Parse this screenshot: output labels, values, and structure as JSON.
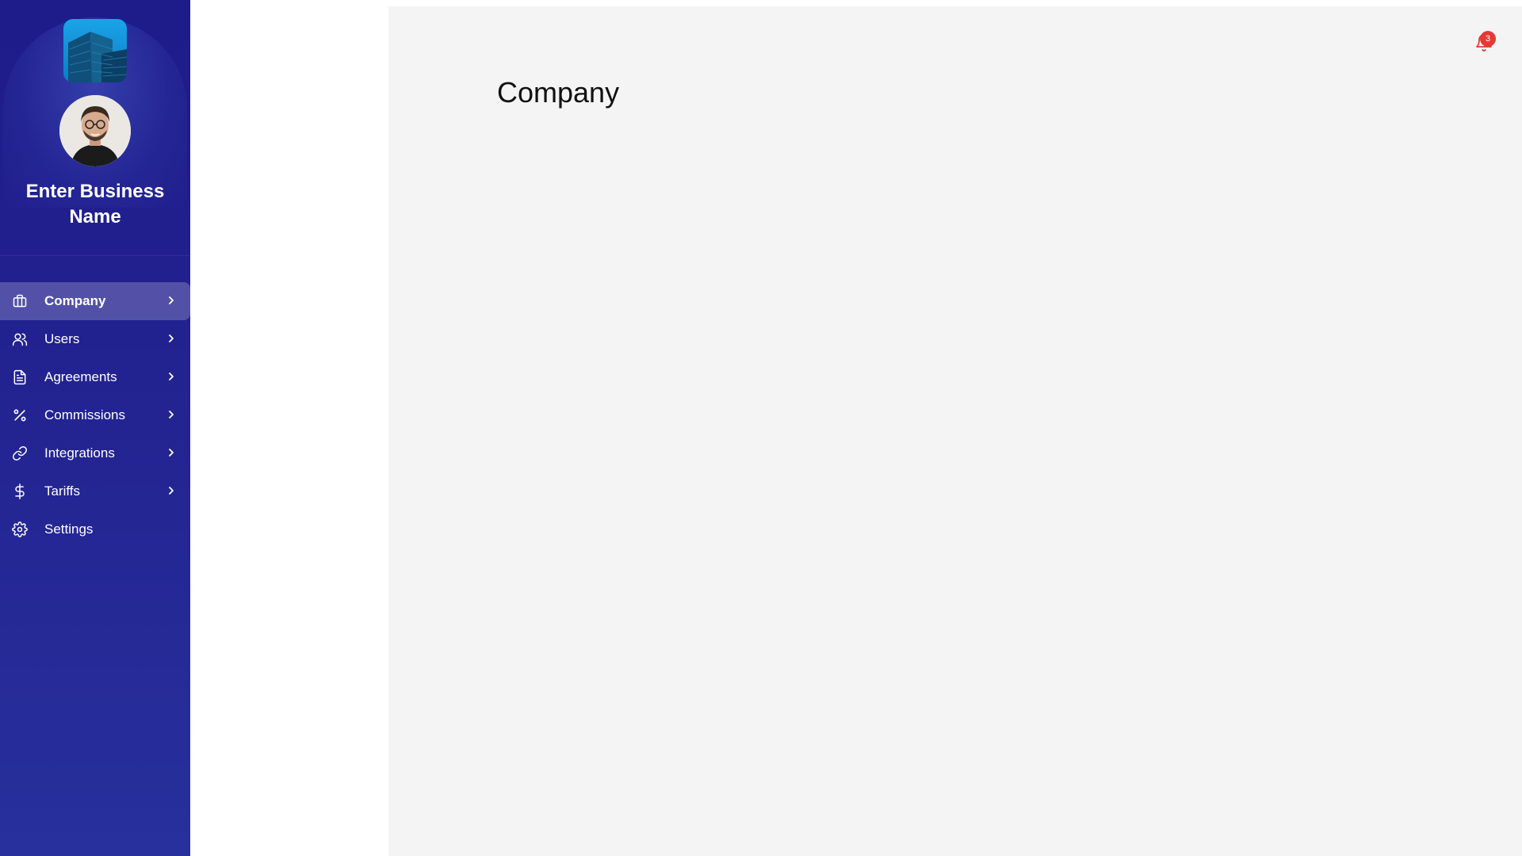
{
  "sidebar": {
    "business_name": "Enter Business Name",
    "logo_icon": "building-icon",
    "avatar_icon": "user-avatar",
    "items": [
      {
        "label": "Company",
        "icon": "briefcase-icon",
        "active": true,
        "has_chevron": true
      },
      {
        "label": "Users",
        "icon": "users-icon",
        "active": false,
        "has_chevron": true
      },
      {
        "label": "Agreements",
        "icon": "document-icon",
        "active": false,
        "has_chevron": true
      },
      {
        "label": "Commissions",
        "icon": "percent-icon",
        "active": false,
        "has_chevron": true
      },
      {
        "label": "Integrations",
        "icon": "link-icon",
        "active": false,
        "has_chevron": true
      },
      {
        "label": "Tariffs",
        "icon": "dollar-icon",
        "active": false,
        "has_chevron": true
      },
      {
        "label": "Settings",
        "icon": "gear-icon",
        "active": false,
        "has_chevron": false
      }
    ]
  },
  "main": {
    "title": "Company",
    "notifications": {
      "icon": "bell-icon",
      "count": "3"
    }
  },
  "colors": {
    "sidebar_top": "#1e1b8a",
    "sidebar_bottom": "#27309c",
    "main_background": "#f4f4f4",
    "badge": "#e53935"
  }
}
